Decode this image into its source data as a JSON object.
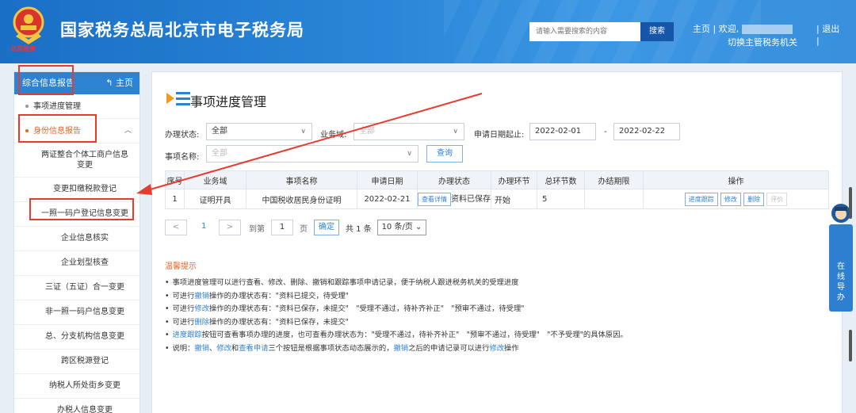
{
  "header": {
    "emblem_text": "北京税务",
    "title": "国家税务总局北京市电子税务局",
    "search_placeholder": "请输入需要搜索的内容",
    "search_button": "搜索",
    "home_link": "主页",
    "welcome": "| 欢迎,",
    "logout": "| 退出",
    "switch_org": "切换主管税务机关",
    "sep": "|"
  },
  "sidebar": {
    "header": "综合信息报告",
    "home": "主页",
    "items": [
      {
        "label": "事项进度管理"
      },
      {
        "label": "身份信息报告"
      }
    ],
    "sub_items": [
      {
        "label": "两证整合个体工商户信息变更"
      },
      {
        "label": "变更扣缴税款登记"
      },
      {
        "label": "一照一码户登记信息变更"
      },
      {
        "label": "企业信息核实"
      },
      {
        "label": "企业划型核查"
      },
      {
        "label": "三证（五证）合一变更"
      },
      {
        "label": "非一照一码户信息变更"
      },
      {
        "label": "总、分支机构信息变更"
      },
      {
        "label": "跨区税源登记"
      },
      {
        "label": "纳税人所处街乡变更"
      },
      {
        "label": "办税人信息变更"
      }
    ]
  },
  "main": {
    "title": "事项进度管理",
    "filters": {
      "status_label": "办理状态:",
      "status_value": "全部",
      "domain_label": "业务域:",
      "domain_value": "全部",
      "date_label": "申请日期起止:",
      "date_from": "2022-02-01",
      "date_sep": "-",
      "date_to": "2022-02-22",
      "name_label": "事项名称:",
      "name_value": "全部",
      "query_button": "查询"
    },
    "table": {
      "headers": [
        "序号",
        "业务域",
        "事项名称",
        "申请日期",
        "办理状态",
        "办理环节",
        "总环节数",
        "办结期限",
        "操作"
      ],
      "rows": [
        {
          "index": "1",
          "domain": "证明开具",
          "name": "中国税收居民身份证明",
          "date": "2022-02-21",
          "detail_btn": "查看详情",
          "status": "资料已保存",
          "stage": "开始",
          "total": "5",
          "deadline": "",
          "actions": [
            "进度跟踪",
            "修改",
            "删除",
            "评价"
          ]
        }
      ]
    },
    "pager": {
      "prev": "<",
      "page": "1",
      "next": ">",
      "goto": "到第",
      "goto_value": "1",
      "page_unit": "页",
      "confirm": "确定",
      "total": "共 1 条",
      "page_size": "10 条/页"
    },
    "tips_title": "温馨提示",
    "tips": {
      "t1": "事项进度管理可以进行查看、修改、删除、撤销和跟踪事项申请记录，便于纳税人跟进税务机关的受理进度",
      "t2_a": "可进行",
      "t2_lk": "撤销",
      "t2_b": "操作的办理状态有：\"资料已提交，待受理\"",
      "t3_a": "可进行",
      "t3_lk": "修改",
      "t3_b": "操作的办理状态有：\"资料已保存，未提交\"　\"受理不通过，待补齐补正\"　\"预审不通过，待受理\"",
      "t4_a": "可进行",
      "t4_lk": "删除",
      "t4_b": "操作的办理状态有：\"资料已保存，未提交\"",
      "t5_lk": "进度跟踪",
      "t5_b": "按钮可查看事项办理的进度，也可查看办理状态为：\"受理不通过，待补齐补正\"　\"预审不通过，待受理\"　\"不予受理\"的具体原因。",
      "t6_a": "说明：",
      "t6_lk1": "撤销",
      "t6_s1": "、",
      "t6_lk2": "修改",
      "t6_s2": "和",
      "t6_lk3": "查看申请",
      "t6_b": "三个按钮是根据事项状态动态展示的，",
      "t6_lk4": "撤销",
      "t6_c": "之后的申请记录可以进行",
      "t6_lk5": "修改",
      "t6_d": "操作"
    }
  },
  "float_service": {
    "label": "在线导办"
  },
  "colors": {
    "brand": "#2d82d2",
    "header": "#1a6fc4",
    "annotation": "#e63b2e",
    "accent": "#e0662a"
  }
}
